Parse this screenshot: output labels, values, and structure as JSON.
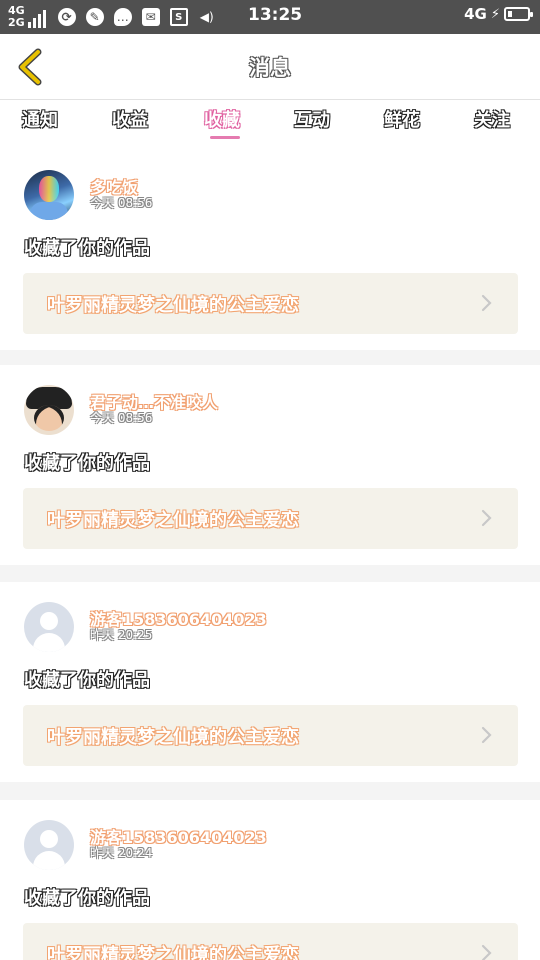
{
  "status_bar": {
    "net_top": "4G",
    "net_bottom": "2G",
    "time": "13:25",
    "right_network": "4G",
    "icons": [
      "signal-icon",
      "app-icon",
      "game-icon",
      "chat-icon",
      "mail-icon",
      "screenshot-icon",
      "volume-icon",
      "battery-icon"
    ]
  },
  "header": {
    "title": "消息",
    "back_icon": "chevron-left-icon"
  },
  "tabs": [
    "通知",
    "收益",
    "收藏",
    "互动",
    "鲜花",
    "关注"
  ],
  "active_tab": 2,
  "colors": {
    "accent": "#e57bb0",
    "name": "#f1a070",
    "card_bg": "#f4f2ea",
    "back_icon": "#e8c100"
  },
  "messages": [
    {
      "avatar": "photo",
      "user": "多吃饭",
      "time": "今天 08:56",
      "action": "收藏了你的作品",
      "work": "叶罗丽精灵梦之仙境的公主爱恋"
    },
    {
      "avatar": "photo",
      "user": "君子动…不准咬人",
      "time": "今天 08:56",
      "action": "收藏了你的作品",
      "work": "叶罗丽精灵梦之仙境的公主爱恋"
    },
    {
      "avatar": "default",
      "user": "游客1583606404023",
      "time": "昨天 20:25",
      "action": "收藏了你的作品",
      "work": "叶罗丽精灵梦之仙境的公主爱恋"
    },
    {
      "avatar": "default",
      "user": "游客1583606404023",
      "time": "昨天 20:24",
      "action": "收藏了你的作品",
      "work": "叶罗丽精灵梦之仙境的公主爱恋"
    }
  ]
}
